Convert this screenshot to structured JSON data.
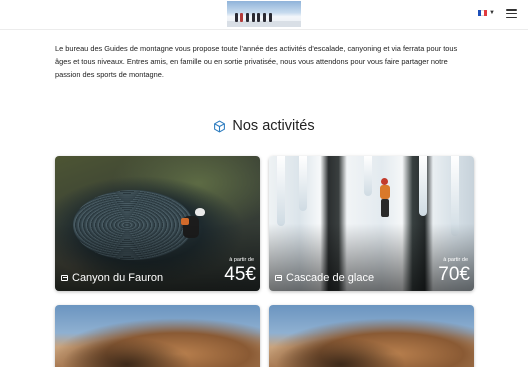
{
  "header": {
    "logo_icon": "mountain-guides-logo",
    "language_icon": "french-flag-icon",
    "menu_icon": "hamburger-menu-icon"
  },
  "intro": {
    "text": "Le bureau des Guides de montagne vous propose toute l'année des activités d'escalade, canyoning et via ferrata pour tous âges et tous niveaux. Entres amis, en famille ou en sortie privatisée, nous vous attendons pour vous faire partager notre passion des sports de montagne."
  },
  "section": {
    "title": "Nos activités",
    "icon": "cube-icon"
  },
  "activities": [
    {
      "name": "Canyon du Fauron",
      "price_label": "à partir de",
      "price": "45€"
    },
    {
      "name": "Cascade de glace",
      "price_label": "à partir de",
      "price": "70€"
    }
  ],
  "colors": {
    "accent": "#2b7bbf",
    "text": "#222222",
    "flag_blue": "#1d4fb8",
    "flag_white": "#ffffff",
    "flag_red": "#e03a3e"
  }
}
